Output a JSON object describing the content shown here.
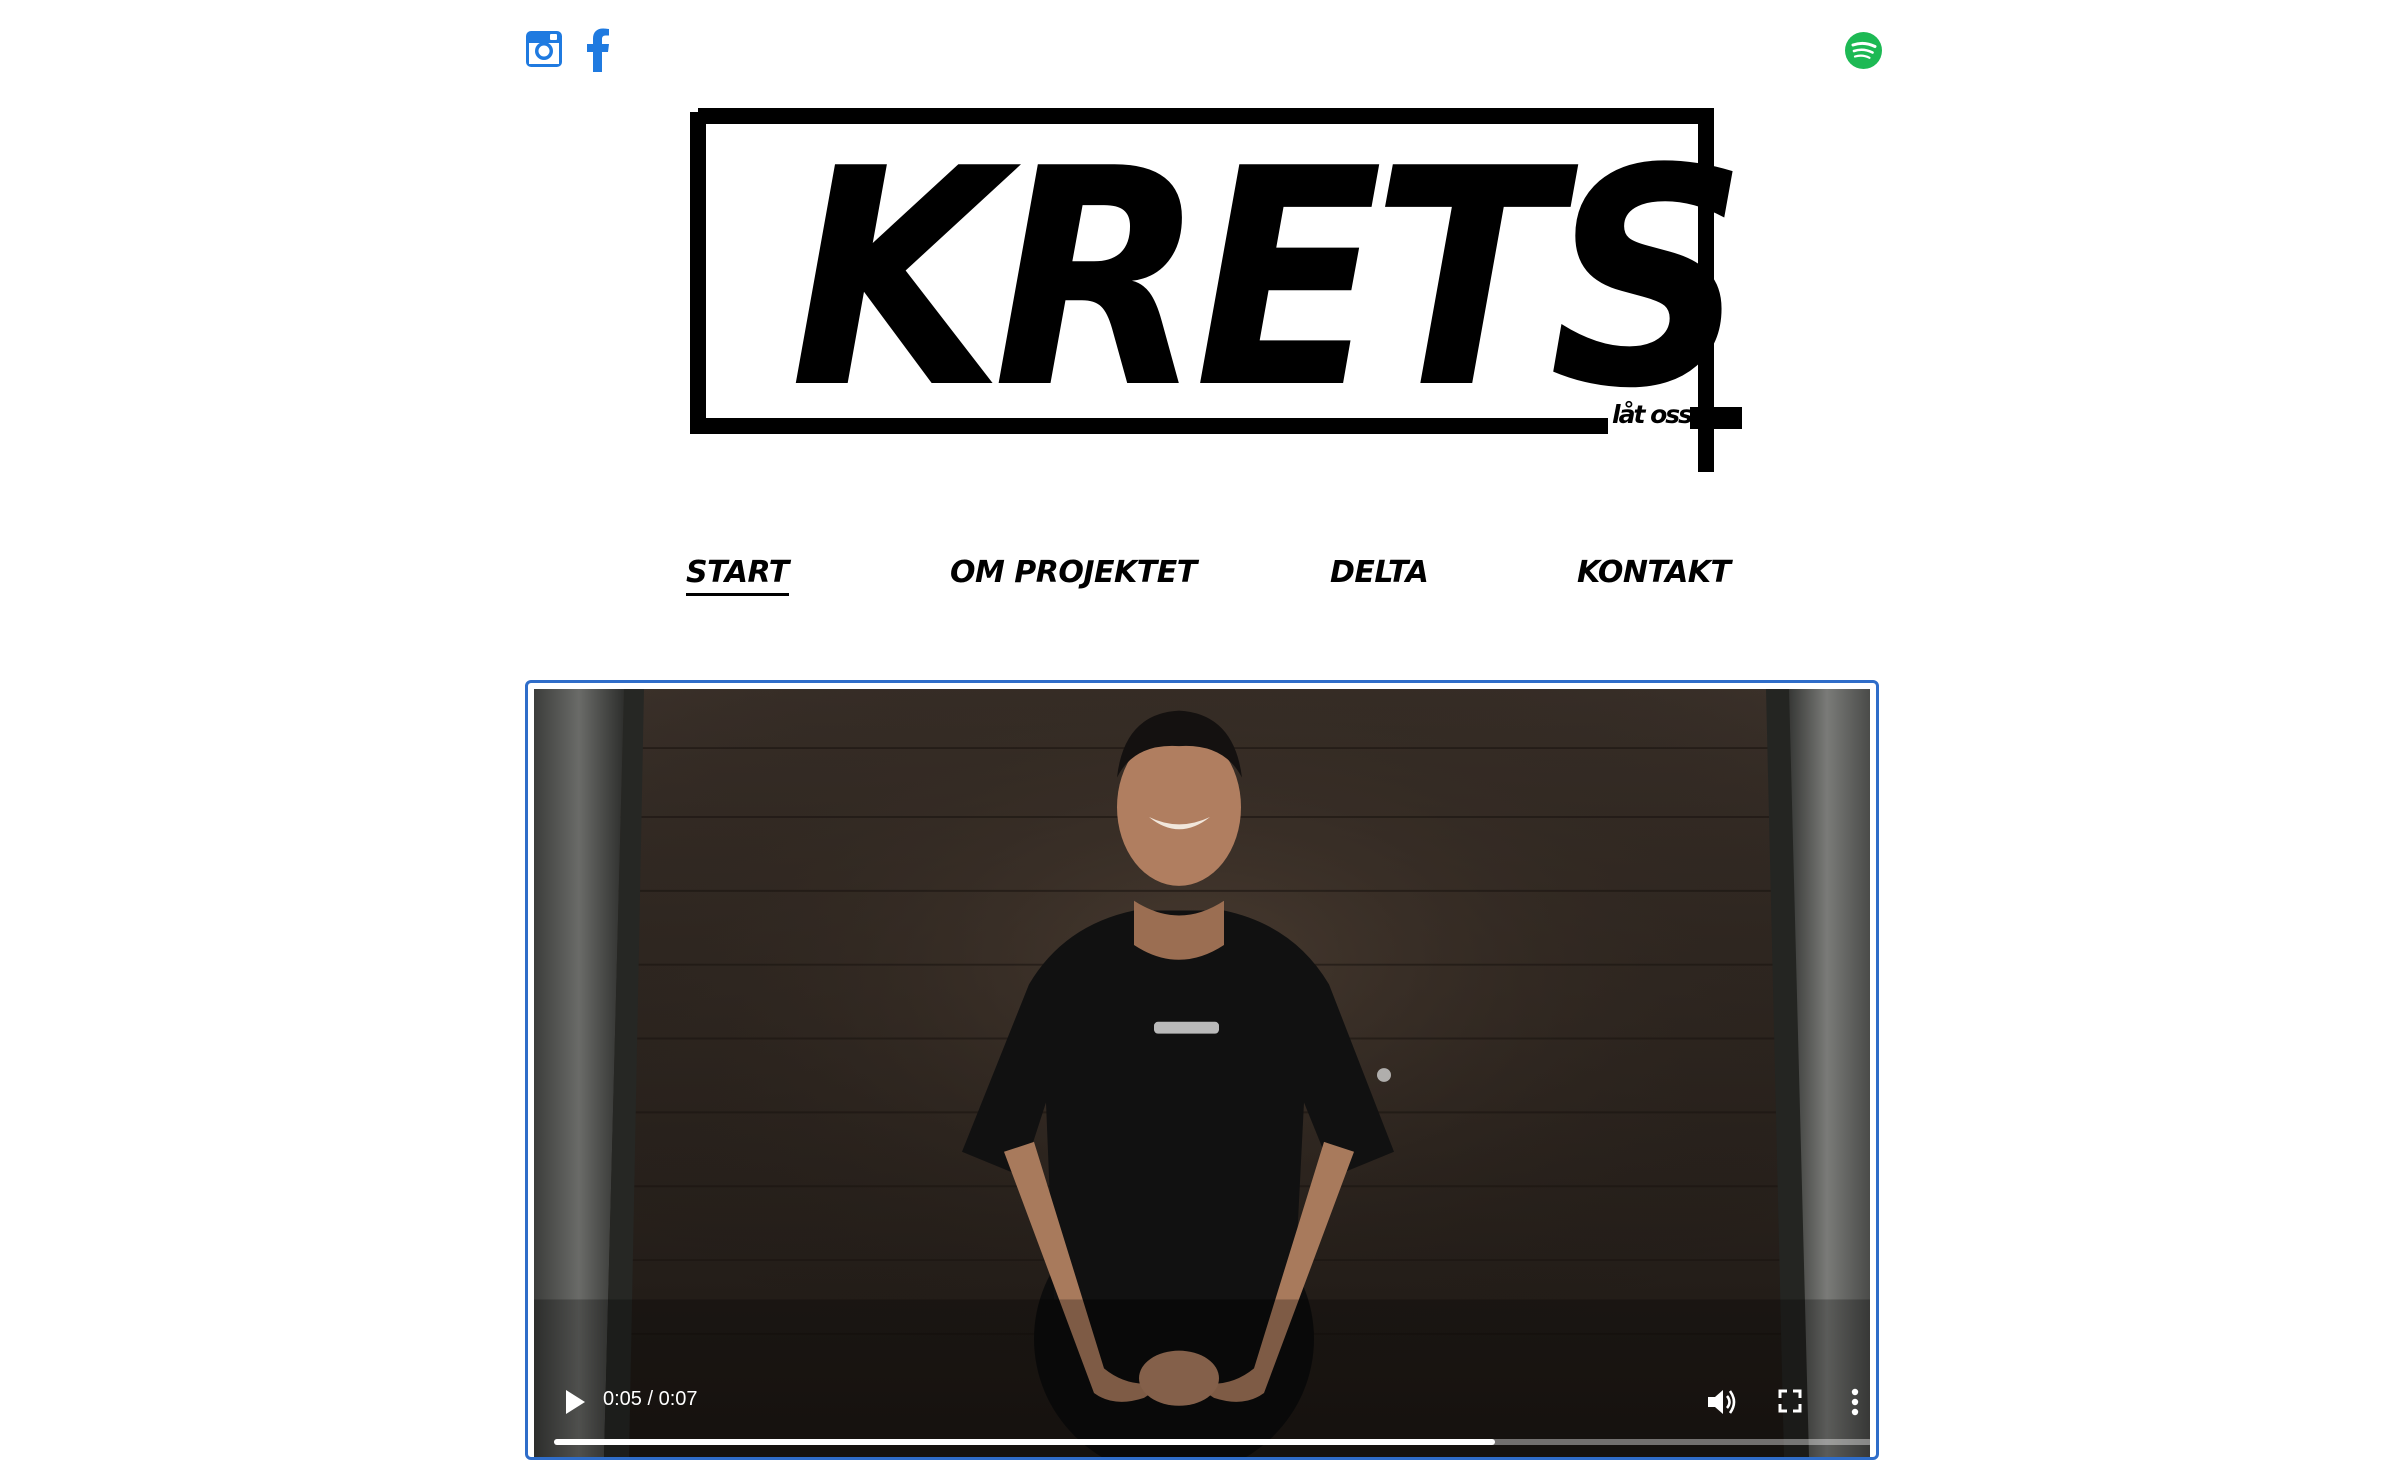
{
  "social": {
    "instagram_icon": "instagram-icon",
    "facebook_icon": "facebook-icon",
    "spotify_icon": "spotify-icon",
    "social_color": "#1f7ae0",
    "spotify_color": "#1db954"
  },
  "logo": {
    "word": "KRETS",
    "tagline": "låt oss."
  },
  "nav": {
    "items": [
      {
        "label": "START",
        "active": true
      },
      {
        "label": "OM PROJEKTET",
        "active": false
      },
      {
        "label": "DELTA",
        "active": false
      },
      {
        "label": "KONTAKT",
        "active": false
      }
    ]
  },
  "video": {
    "time_display": "0:05 / 0:07",
    "progress_fraction": 0.714,
    "play_icon": "play-icon",
    "volume_icon": "volume-icon",
    "fullscreen_icon": "fullscreen-icon",
    "more_icon": "more-options-icon",
    "frame_border_color": "#2f6dc9"
  }
}
